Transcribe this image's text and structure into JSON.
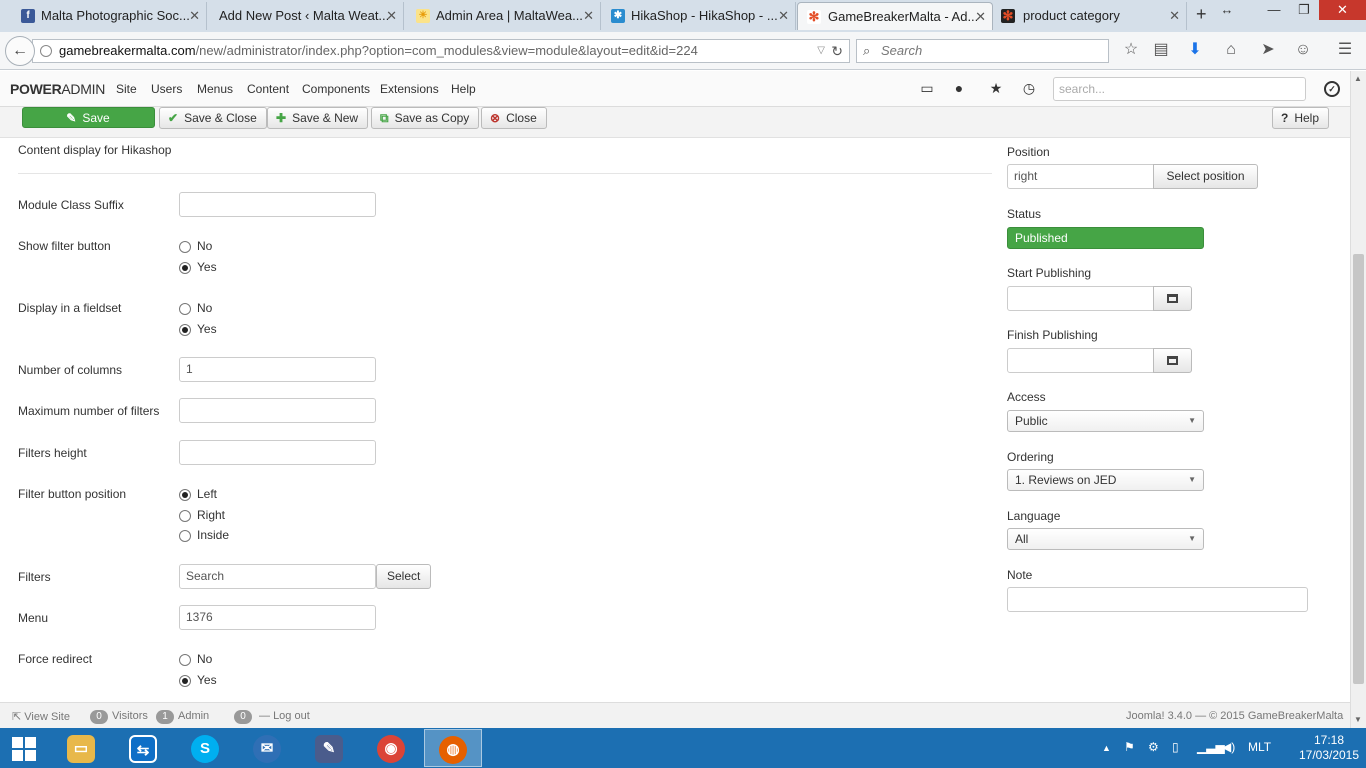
{
  "browser": {
    "tabs": [
      {
        "title": "Malta Photographic Soc...",
        "favicon": "facebook-icon",
        "color": "#3b5998",
        "glyph": "f"
      },
      {
        "title": "Add New Post ‹ Malta Weat...",
        "favicon": "blank-page-icon",
        "color": "#ffffff",
        "glyph": ""
      },
      {
        "title": "Admin Area | MaltaWea...",
        "favicon": "sun-icon",
        "color": "#f5a623",
        "glyph": "☀"
      },
      {
        "title": "HikaShop - HikaShop - ...",
        "favicon": "hikashop-icon",
        "color": "#2a8ccf",
        "glyph": "✱"
      },
      {
        "title": "GameBreakerMalta - Ad...",
        "favicon": "joomla-icon",
        "color": "#e44d26",
        "glyph": "✻"
      },
      {
        "title": "product category",
        "favicon": "joomla-icon",
        "color": "#e44d26",
        "glyph": "✻"
      }
    ],
    "url_host": "gamebreakermalta.com",
    "url_path": "/new/administrator/index.php?option=com_modules&view=module&layout=edit&id=224",
    "search_placeholder": "Search"
  },
  "admin": {
    "brand_bold": "POWER",
    "brand_rest": "ADMIN",
    "menu": [
      "Site",
      "Users",
      "Menus",
      "Content",
      "Components",
      "Extensions",
      "Help"
    ],
    "search_placeholder": "search..."
  },
  "toolbar": {
    "save": "Save",
    "save_close": "Save & Close",
    "save_new": "Save & New",
    "save_copy": "Save as Copy",
    "close": "Close",
    "help": "Help"
  },
  "form": {
    "description": "Content display for Hikashop",
    "module_class_suffix": {
      "label": "Module Class Suffix",
      "value": ""
    },
    "show_filter_button": {
      "label": "Show filter button",
      "options": [
        "No",
        "Yes"
      ],
      "selected": "Yes"
    },
    "display_fieldset": {
      "label": "Display in a fieldset",
      "options": [
        "No",
        "Yes"
      ],
      "selected": "Yes"
    },
    "number_columns": {
      "label": "Number of columns",
      "value": "1"
    },
    "max_filters": {
      "label": "Maximum number of filters",
      "value": ""
    },
    "filters_height": {
      "label": "Filters height",
      "value": ""
    },
    "filter_button_position": {
      "label": "Filter button position",
      "options": [
        "Left",
        "Right",
        "Inside"
      ],
      "selected": "Left"
    },
    "filters": {
      "label": "Filters",
      "value": "Search",
      "button": "Select"
    },
    "menu": {
      "label": "Menu",
      "value": "1376"
    },
    "force_redirect": {
      "label": "Force redirect",
      "options": [
        "No",
        "Yes"
      ],
      "selected": "Yes"
    }
  },
  "sidebar": {
    "position": {
      "label": "Position",
      "value": "right",
      "button": "Select position"
    },
    "status": {
      "label": "Status",
      "value": "Published"
    },
    "start_publishing": {
      "label": "Start Publishing",
      "value": ""
    },
    "finish_publishing": {
      "label": "Finish Publishing",
      "value": ""
    },
    "access": {
      "label": "Access",
      "value": "Public"
    },
    "ordering": {
      "label": "Ordering",
      "value": "1. Reviews on JED"
    },
    "language": {
      "label": "Language",
      "value": "All"
    },
    "note": {
      "label": "Note",
      "value": ""
    }
  },
  "footer": {
    "view_site": "View Site",
    "visitors_count": "0",
    "visitors_label": "Visitors",
    "admin_count": "1",
    "admin_label": "Admin",
    "messages_count": "0",
    "logout": "Log out",
    "copyright": "Joomla! 3.4.0 — © 2015 GameBreakerMalta"
  },
  "taskbar": {
    "apps": [
      {
        "name": "file-explorer-icon",
        "color": "#e8b84a",
        "glyph": "▭"
      },
      {
        "name": "teamviewer-icon",
        "color": "#0e6fc7",
        "glyph": "⇆"
      },
      {
        "name": "skype-icon",
        "color": "#00aff0",
        "glyph": "S"
      },
      {
        "name": "thunderbird-icon",
        "color": "#2f6fb5",
        "glyph": "✉"
      },
      {
        "name": "image-editor-icon",
        "color": "#4a5c8c",
        "glyph": "✎"
      },
      {
        "name": "chrome-icon",
        "color": "#db4437",
        "glyph": "◉"
      },
      {
        "name": "firefox-icon",
        "color": "#e66000",
        "glyph": "◍"
      }
    ],
    "language": "MLT",
    "time": "17:18",
    "date": "17/03/2015"
  }
}
